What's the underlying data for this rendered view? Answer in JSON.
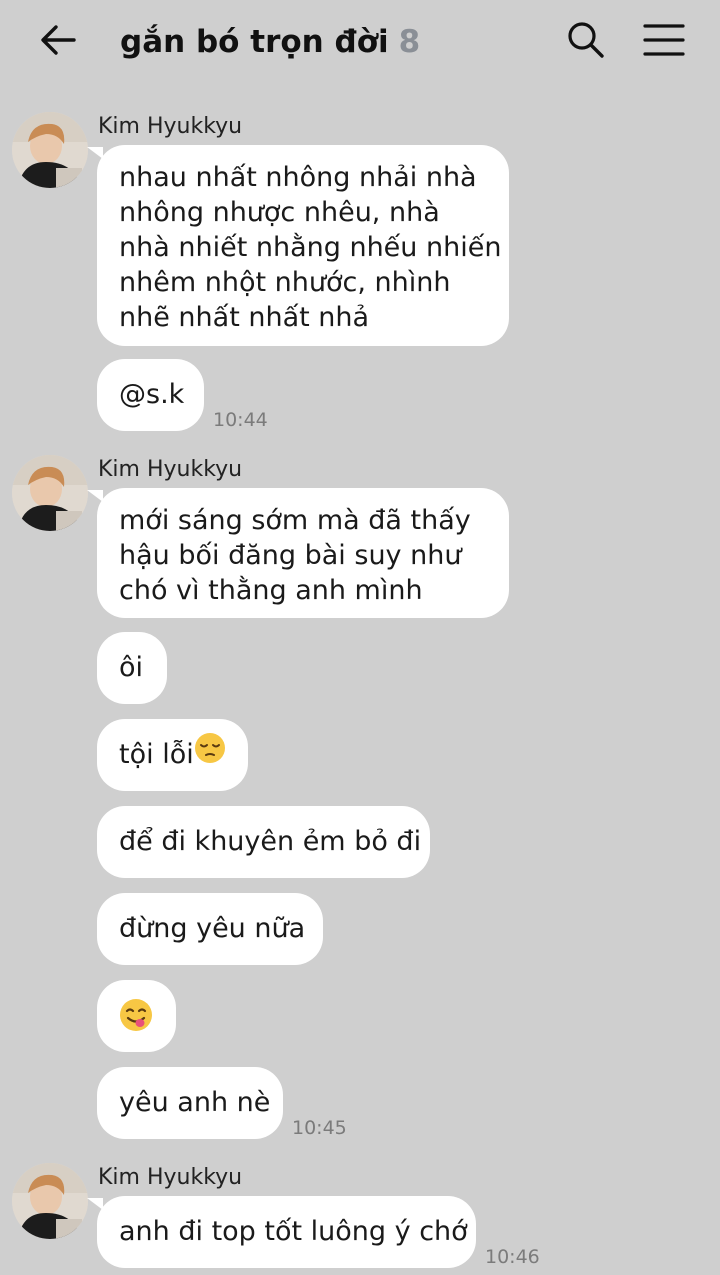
{
  "header": {
    "title": "gắn bó trọn đời",
    "member_count": "8",
    "back_icon": "arrow-left-icon",
    "search_icon": "search-icon",
    "menu_icon": "hamburger-menu-icon"
  },
  "colors": {
    "background": "#cfcfcf",
    "bubble": "#ffffff",
    "count": "#8a8f96",
    "timestamp": "#7b7b7b"
  },
  "messages": {
    "group1": {
      "sender": "Kim Hyukkyu",
      "avatar_icon": "avatar-kim-hyukkyu",
      "lines": [
        "nhau nhất nhông nhải nhà",
        "nhông nhược nhêu, nhà",
        "nhà nhiết nhằng nhếu nhiến",
        "nhêm nhột nhước, nhình",
        "nhẽ nhất nhất nhả"
      ],
      "mention": "@s.k",
      "time": "10:44"
    },
    "group2": {
      "sender": "Kim Hyukkyu",
      "avatar_icon": "avatar-kim-hyukkyu",
      "lines": [
        "mới sáng sớm mà đã thấy",
        "hậu bối đăng bài suy như",
        "chó vì thằng anh mình"
      ],
      "msg_oi": "ôi",
      "msg_toi_loi": "tội lỗi",
      "toi_loi_emoji": "pensive-face-emoji",
      "msg_khuyen": "để đi khuyên ẻm bỏ đi",
      "msg_dung_yeu": "đừng yêu nữa",
      "msg_emoji": "face-savoring-food-emoji",
      "msg_yeu_anh": "yêu anh nè",
      "time": "10:45"
    },
    "group3": {
      "sender": "Kim Hyukkyu",
      "avatar_icon": "avatar-kim-hyukkyu",
      "msg": "anh đi top tốt luông ý chớ",
      "time": "10:46"
    }
  }
}
